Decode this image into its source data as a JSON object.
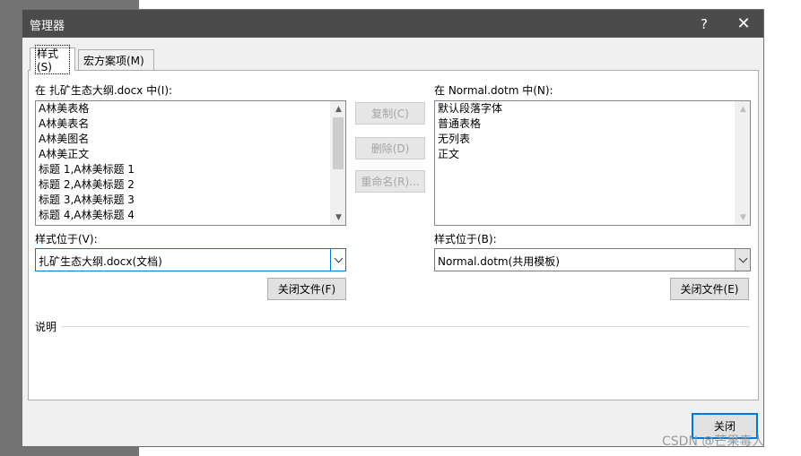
{
  "dialog": {
    "title": "管理器",
    "help_label": "?",
    "close_label": "✕"
  },
  "tabs": [
    {
      "label": "样式(S)",
      "active": true
    },
    {
      "label": "宏方案项(M)",
      "active": false
    }
  ],
  "left": {
    "list_label": "在 扎矿生态大纲.docx 中(I):",
    "items": [
      "A林美表格",
      "A林美表名",
      "A林美图名",
      "A林美正文",
      "标题 1,A林美标题 1",
      "标题 2,A林美标题 2",
      "标题 3,A林美标题 3",
      "标题 4,A林美标题 4"
    ],
    "location_label": "样式位于(V):",
    "location_value": "扎矿生态大纲.docx(文档)",
    "close_file_label": "关闭文件(F)"
  },
  "right": {
    "list_label": "在 Normal.dotm 中(N):",
    "items": [
      "默认段落字体",
      "普通表格",
      "无列表",
      "正文"
    ],
    "location_label": "样式位于(B):",
    "location_value": "Normal.dotm(共用模板)",
    "close_file_label": "关闭文件(E)"
  },
  "middle": {
    "copy_label": "复制(C)",
    "delete_label": "删除(D)",
    "rename_label": "重命名(R)..."
  },
  "description_label": "说明",
  "footer": {
    "close_label": "关闭"
  },
  "watermark": "CSDN @芒果毒人"
}
